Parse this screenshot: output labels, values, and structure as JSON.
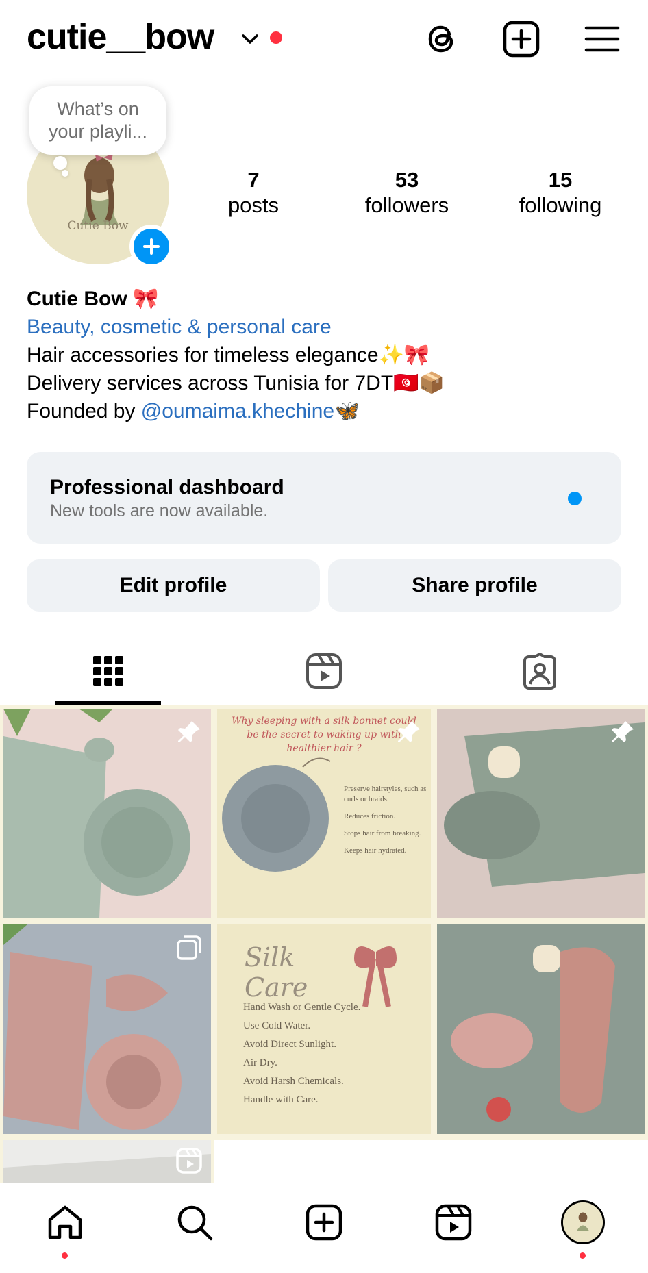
{
  "colors": {
    "accent_blue": "#0095f6",
    "link_blue": "#2b6fbf",
    "notification_red": "#ff3040",
    "surface_gray": "#eff2f5"
  },
  "header": {
    "username": "cutie__bow",
    "icons": [
      "chevron-down-icon",
      "threads-icon",
      "create-post-icon",
      "menu-icon"
    ]
  },
  "profile": {
    "note_bubble": "What’s on your playli...",
    "avatar_text": "Cutie Bow",
    "stats": [
      {
        "number": "7",
        "label": "posts"
      },
      {
        "number": "53",
        "label": "followers"
      },
      {
        "number": "15",
        "label": "following"
      }
    ],
    "name": "Cutie Bow 🎀",
    "category": "Beauty, cosmetic & personal care",
    "bio_line1": "Hair accessories for timeless elegance✨🎀",
    "bio_line2": "Delivery services across Tunisia for 7DT🇹🇳📦",
    "bio_line3_prefix": "Founded by ",
    "bio_mention": "@oumaima.khechine",
    "bio_line3_suffix": "🦋"
  },
  "dashboard": {
    "title": "Professional dashboard",
    "subtitle": "New tools are now available."
  },
  "buttons": {
    "edit_profile": "Edit profile",
    "share_profile": "Share profile"
  },
  "tabs": [
    "grid-icon",
    "reels-icon",
    "tagged-icon"
  ],
  "posts": [
    {
      "badge": "pin-icon"
    },
    {
      "badge": "pin-icon",
      "title_line1": "Why sleeping with a silk bonnet could",
      "title_line2": "be the secret to waking up with",
      "title_line3": "healthier hair ?",
      "items": [
        "Preserve hairstyles, such as curls or braids.",
        "Reduces friction.",
        "Stops hair from breaking.",
        "Keeps hair hydrated."
      ]
    },
    {
      "badge": "pin-icon"
    },
    {
      "badge": "carousel-icon"
    },
    {
      "title": "Silk Care",
      "items": [
        "Hand Wash or Gentle Cycle.",
        "Use Cold Water.",
        "Avoid Direct Sunlight.",
        "Air Dry.",
        "Avoid Harsh Chemicals.",
        "Handle with Care."
      ]
    },
    {
      "badge": "none"
    },
    {
      "badge": "reel-icon"
    }
  ],
  "bottom_nav": [
    "home-icon",
    "search-icon",
    "create-icon",
    "reels-icon",
    "profile-avatar"
  ]
}
